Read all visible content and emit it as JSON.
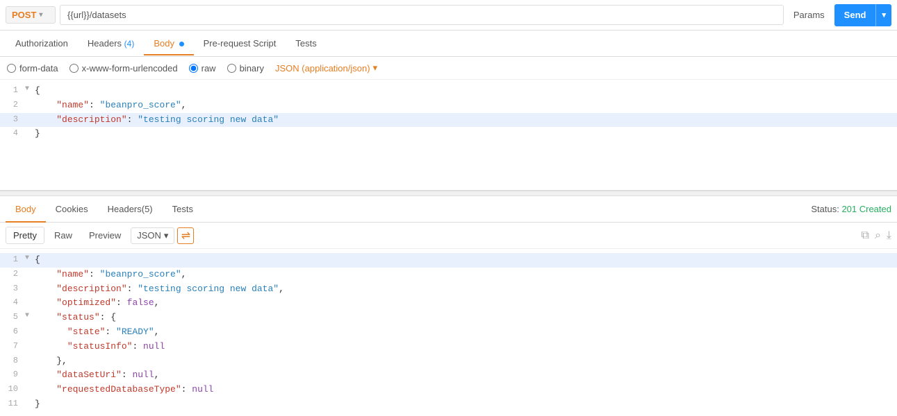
{
  "topbar": {
    "method": "POST",
    "url": "{{url}}/datasets",
    "params_label": "Params",
    "send_label": "Send"
  },
  "request_tabs": [
    {
      "id": "authorization",
      "label": "Authorization",
      "badge": null,
      "dot": false,
      "active": false
    },
    {
      "id": "headers",
      "label": "Headers",
      "badge": "(4)",
      "dot": false,
      "active": false
    },
    {
      "id": "body",
      "label": "Body",
      "badge": null,
      "dot": true,
      "active": true
    },
    {
      "id": "prerequest",
      "label": "Pre-request Script",
      "badge": null,
      "dot": false,
      "active": false
    },
    {
      "id": "tests",
      "label": "Tests",
      "badge": null,
      "dot": false,
      "active": false
    }
  ],
  "body_options": {
    "form_data": "form-data",
    "urlencoded": "x-www-form-urlencoded",
    "raw": "raw",
    "binary": "binary",
    "json_type": "JSON (application/json)"
  },
  "request_body_lines": [
    {
      "num": 1,
      "toggle": "▼",
      "content": "{",
      "type": "punct"
    },
    {
      "num": 2,
      "toggle": "",
      "key": "\"name\"",
      "colon": ": ",
      "value": "\"beanpro_score\"",
      "comma": ",",
      "highlighted": false
    },
    {
      "num": 3,
      "toggle": "",
      "key": "\"description\"",
      "colon": ": ",
      "value": "\"testing scoring new data\"",
      "comma": "",
      "highlighted": true
    },
    {
      "num": 4,
      "toggle": "",
      "content": "}",
      "type": "punct",
      "highlighted": false
    }
  ],
  "response": {
    "status_label": "Status:",
    "status_code": "201 Created",
    "tabs": [
      {
        "id": "body",
        "label": "Body",
        "active": true
      },
      {
        "id": "cookies",
        "label": "Cookies",
        "active": false
      },
      {
        "id": "headers",
        "label": "Headers",
        "badge": "(5)",
        "active": false
      },
      {
        "id": "tests",
        "label": "Tests",
        "active": false
      }
    ],
    "toolbar": {
      "pretty_label": "Pretty",
      "raw_label": "Raw",
      "preview_label": "Preview",
      "format": "JSON"
    },
    "body_lines": [
      {
        "num": 1,
        "toggle": "▼",
        "content": "{",
        "highlighted": true
      },
      {
        "num": 2,
        "toggle": "",
        "key": "\"name\"",
        "colon": ": ",
        "value": "\"beanpro_score\"",
        "comma": ",",
        "highlighted": false
      },
      {
        "num": 3,
        "toggle": "",
        "key": "\"description\"",
        "colon": ": ",
        "value": "\"testing scoring new data\"",
        "comma": ",",
        "highlighted": false
      },
      {
        "num": 4,
        "toggle": "",
        "key": "\"optimized\"",
        "colon": ": ",
        "value": "false",
        "valueType": "bool",
        "comma": ",",
        "highlighted": false
      },
      {
        "num": 5,
        "toggle": "▼",
        "key": "\"status\"",
        "colon": ": ",
        "value": "{",
        "comma": "",
        "highlighted": false
      },
      {
        "num": 6,
        "toggle": "",
        "key2": "\"state\"",
        "colon2": ": ",
        "value2": "\"READY\"",
        "comma": ",",
        "highlighted": false,
        "indent": 2
      },
      {
        "num": 7,
        "toggle": "",
        "key2": "\"statusInfo\"",
        "colon2": ": ",
        "value2": "null",
        "valueType2": "null",
        "comma": "",
        "highlighted": false,
        "indent": 2
      },
      {
        "num": 8,
        "toggle": "",
        "content": "  },",
        "highlighted": false
      },
      {
        "num": 9,
        "toggle": "",
        "key": "\"dataSetUri\"",
        "colon": ": ",
        "value": "null",
        "valueType": "null",
        "comma": ",",
        "highlighted": false
      },
      {
        "num": 10,
        "toggle": "",
        "key": "\"requestedDatabaseType\"",
        "colon": ": ",
        "value": "null",
        "valueType": "null",
        "comma": "",
        "highlighted": false
      },
      {
        "num": 11,
        "toggle": "",
        "content": "}",
        "highlighted": false
      }
    ]
  }
}
